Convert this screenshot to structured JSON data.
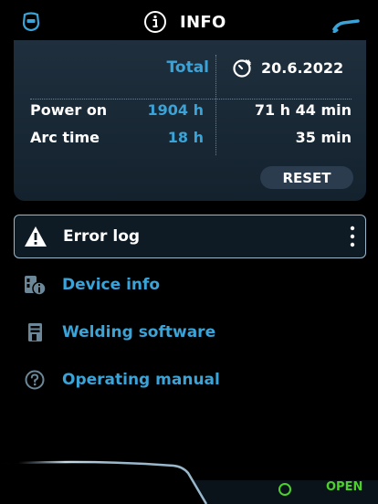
{
  "header": {
    "title": "INFO",
    "left_icon": "welding-helmet-icon",
    "center_icon": "info-icon",
    "right_icon": "welding-torch-icon"
  },
  "stats": {
    "total_header": "Total",
    "since_date": "20.6.2022",
    "since_icon": "stopwatch-reset-icon",
    "rows": [
      {
        "label": "Power on",
        "total": "1904 h",
        "since": "71 h 44 min"
      },
      {
        "label": "Arc time",
        "total": "18 h",
        "since": "35 min"
      }
    ],
    "reset_label": "RESET"
  },
  "menu": {
    "items": [
      {
        "label": "Error log",
        "icon": "warning-icon",
        "selected": true
      },
      {
        "label": "Device info",
        "icon": "device-info-icon"
      },
      {
        "label": "Welding software",
        "icon": "document-icon"
      },
      {
        "label": "Operating manual",
        "icon": "help-icon"
      }
    ]
  },
  "footer": {
    "status_label": "OPEN",
    "status_color": "#4bd12a"
  },
  "colors": {
    "accent": "#3aa3d8",
    "panel": "#1a2a38",
    "background": "#000000"
  }
}
